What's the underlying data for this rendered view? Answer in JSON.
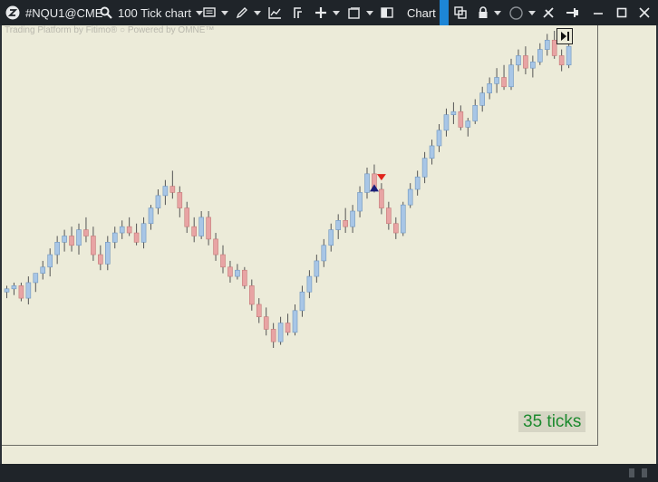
{
  "toolbar": {
    "symbol": "#NQU1@CME",
    "chart_type": "100 Tick chart",
    "tab_label": "Chart"
  },
  "chart": {
    "watermark": "Trading Platform by Fitimo®  ○ Powered by OMNE™",
    "ticks_label": "35 ticks",
    "colors": {
      "up": "#a8c6e6",
      "down": "#e8a4a4",
      "wick": "#555555",
      "buy_marker": "#1a1f7a",
      "sell_marker": "#e0241c"
    }
  },
  "chart_data": {
    "type": "candlestick",
    "candles": [
      [
        28,
        30,
        26,
        29
      ],
      [
        29,
        31,
        27,
        30
      ],
      [
        30,
        31,
        25,
        26
      ],
      [
        26,
        33,
        24,
        31
      ],
      [
        31,
        34,
        28,
        34
      ],
      [
        34,
        38,
        32,
        36
      ],
      [
        36,
        42,
        33,
        40
      ],
      [
        40,
        46,
        37,
        44
      ],
      [
        44,
        48,
        41,
        46
      ],
      [
        46,
        49,
        41,
        43
      ],
      [
        43,
        50,
        40,
        48
      ],
      [
        48,
        52,
        44,
        46
      ],
      [
        46,
        49,
        38,
        40
      ],
      [
        40,
        43,
        35,
        37
      ],
      [
        37,
        46,
        35,
        44
      ],
      [
        44,
        49,
        42,
        47
      ],
      [
        47,
        51,
        45,
        49
      ],
      [
        49,
        52,
        46,
        47
      ],
      [
        47,
        50,
        43,
        44
      ],
      [
        44,
        52,
        42,
        50
      ],
      [
        50,
        56,
        48,
        55
      ],
      [
        55,
        61,
        53,
        59
      ],
      [
        59,
        64,
        56,
        62
      ],
      [
        62,
        67,
        58,
        60
      ],
      [
        60,
        62,
        52,
        55
      ],
      [
        55,
        57,
        47,
        49
      ],
      [
        49,
        52,
        44,
        46
      ],
      [
        46,
        54,
        45,
        52
      ],
      [
        52,
        54,
        43,
        45
      ],
      [
        45,
        47,
        38,
        40
      ],
      [
        40,
        43,
        34,
        36
      ],
      [
        36,
        38,
        31,
        33
      ],
      [
        33,
        37,
        32,
        35
      ],
      [
        35,
        36,
        29,
        30
      ],
      [
        30,
        32,
        22,
        24
      ],
      [
        24,
        26,
        18,
        20
      ],
      [
        20,
        23,
        14,
        16
      ],
      [
        16,
        18,
        10,
        12
      ],
      [
        12,
        20,
        11,
        18
      ],
      [
        18,
        21,
        14,
        15
      ],
      [
        15,
        24,
        14,
        22
      ],
      [
        22,
        30,
        20,
        28
      ],
      [
        28,
        35,
        26,
        33
      ],
      [
        33,
        40,
        31,
        38
      ],
      [
        38,
        45,
        36,
        43
      ],
      [
        43,
        50,
        41,
        48
      ],
      [
        48,
        53,
        45,
        51
      ],
      [
        51,
        55,
        47,
        49
      ],
      [
        49,
        56,
        47,
        54
      ],
      [
        54,
        62,
        52,
        60
      ],
      [
        60,
        68,
        58,
        66
      ],
      [
        66,
        69,
        60,
        61
      ],
      [
        61,
        63,
        53,
        55
      ],
      [
        55,
        57,
        48,
        50
      ],
      [
        50,
        52,
        45,
        47
      ],
      [
        47,
        57,
        46,
        56
      ],
      [
        56,
        63,
        55,
        61
      ],
      [
        61,
        67,
        59,
        65
      ],
      [
        65,
        73,
        63,
        71
      ],
      [
        71,
        77,
        69,
        75
      ],
      [
        75,
        82,
        73,
        80
      ],
      [
        80,
        87,
        78,
        85
      ],
      [
        85,
        89,
        82,
        86
      ],
      [
        86,
        88,
        80,
        81
      ],
      [
        81,
        84,
        78,
        83
      ],
      [
        83,
        90,
        82,
        88
      ],
      [
        88,
        94,
        86,
        92
      ],
      [
        92,
        97,
        90,
        95
      ],
      [
        95,
        100,
        92,
        97
      ],
      [
        97,
        101,
        93,
        94
      ],
      [
        94,
        103,
        93,
        101
      ],
      [
        101,
        106,
        99,
        104
      ],
      [
        104,
        107,
        98,
        100
      ],
      [
        100,
        104,
        97,
        102
      ],
      [
        102,
        108,
        101,
        106
      ],
      [
        106,
        111,
        104,
        109
      ],
      [
        109,
        112,
        103,
        104
      ],
      [
        104,
        106,
        99,
        101
      ],
      [
        101,
        108,
        100,
        107
      ]
    ],
    "markers": [
      {
        "type": "buy",
        "index": 51
      },
      {
        "type": "sell",
        "index": 52
      }
    ]
  }
}
